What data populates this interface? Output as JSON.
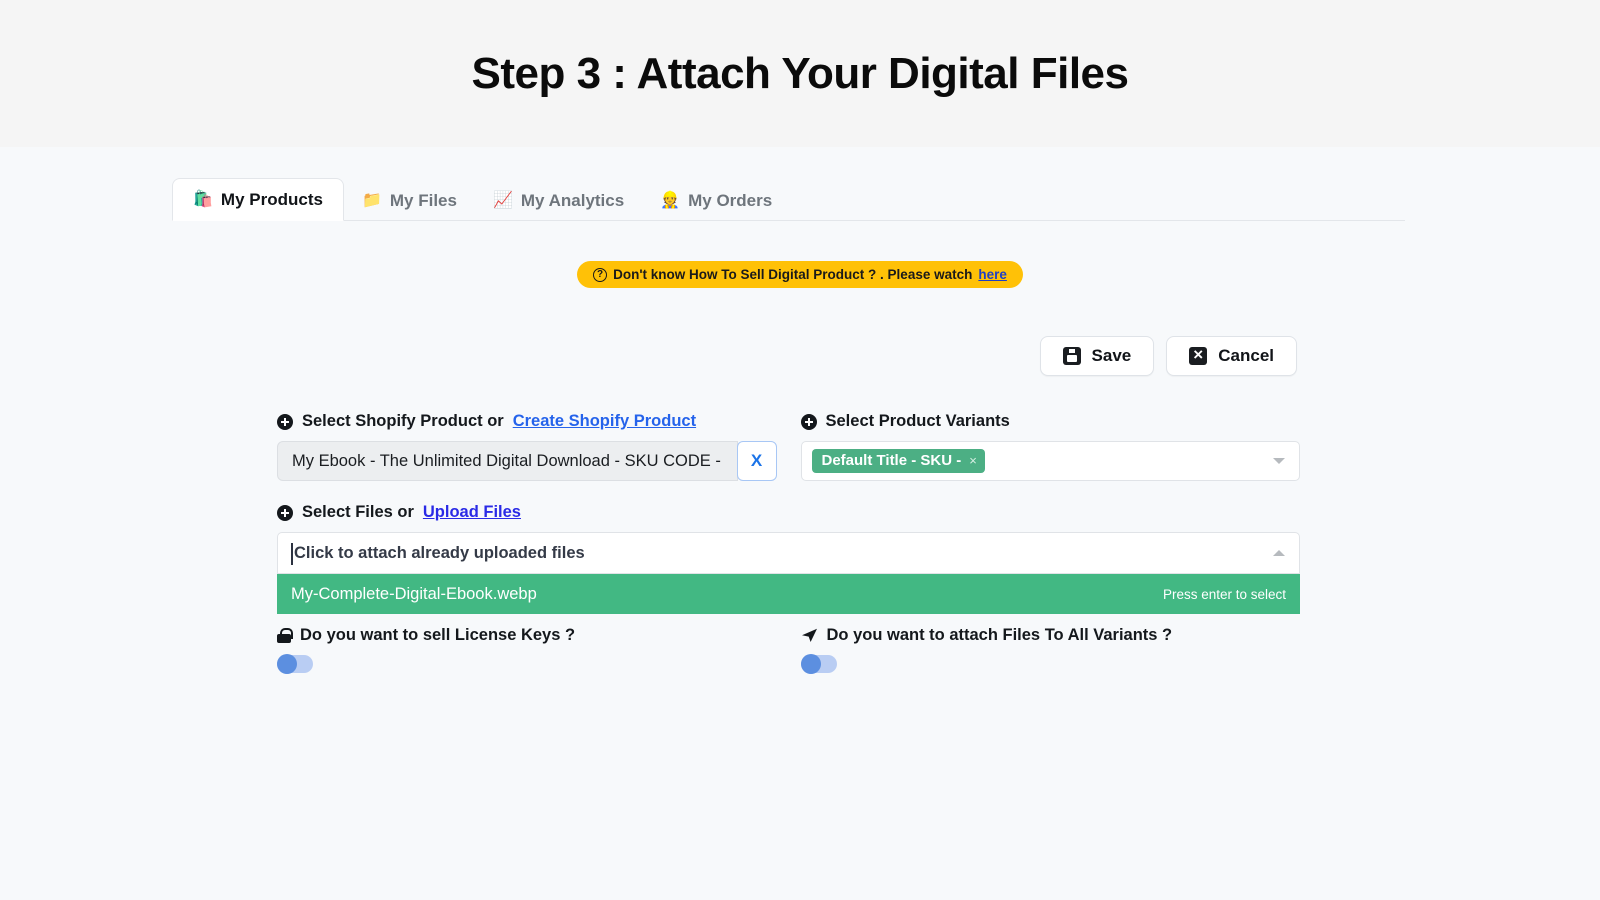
{
  "header": {
    "title": "Step 3 : Attach Your Digital Files"
  },
  "tabs": [
    {
      "label": "My Products",
      "icon": "shopping-bags-icon",
      "glyph": "🛍️",
      "active": true
    },
    {
      "label": "My Files",
      "icon": "folder-icon",
      "glyph": "📁",
      "active": false
    },
    {
      "label": "My Analytics",
      "icon": "chart-icon",
      "glyph": "📈",
      "active": false
    },
    {
      "label": "My Orders",
      "icon": "person-icon",
      "glyph": "👷",
      "active": false
    }
  ],
  "banner": {
    "icon": "question-mark-circle-icon",
    "glyph": "?",
    "text": "Don't know How To Sell Digital Product ? . Please watch",
    "link_label": "here",
    "background": "#ffc107"
  },
  "toolbar": {
    "save_label": "Save",
    "cancel_label": "Cancel"
  },
  "form": {
    "product": {
      "label": "Select Shopify Product or",
      "link_label": "Create Shopify Product",
      "value": "My Ebook - The Unlimited Digital Download - SKU CODE -",
      "clear_label": "X"
    },
    "variants": {
      "label": "Select Product Variants",
      "chip_label": "Default Title - SKU -",
      "chip_remove": "×",
      "chip_color": "#4caf84"
    },
    "files": {
      "label": "Select Files or",
      "link_label": "Upload Files",
      "placeholder": "Click to attach already uploaded files",
      "option_name": "My-Complete-Digital-Ebook.webp",
      "option_hint": "Press enter to select",
      "option_color": "#42b883"
    },
    "license_keys": {
      "icon": "lock-icon",
      "label": "Do you want to sell License Keys ?",
      "toggle_state": "off"
    },
    "all_variants": {
      "icon": "send-icon",
      "label": "Do you want to attach Files To All Variants ?",
      "toggle_state": "off"
    }
  }
}
